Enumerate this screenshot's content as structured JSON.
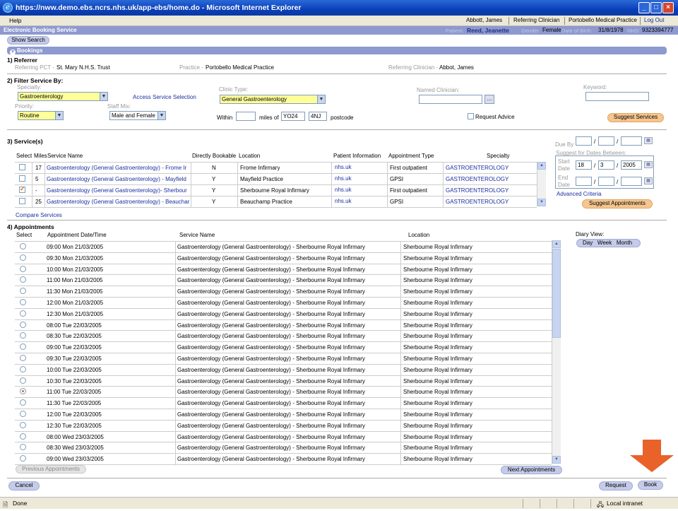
{
  "window": {
    "title": "https://nww.demo.ebs.ncrs.nhs.uk/app-ebs/home.do - Microsoft Internet Explorer"
  },
  "menu": {
    "help": "Help",
    "user": "Abbott, James",
    "role": "Referring Clinician",
    "practice": "Portobello Medical Practice",
    "logout": "Log Out"
  },
  "ebs_bar": {
    "title": "Electronic Booking Service",
    "patient_label": "Patient:",
    "patient": "Reed, Jeanette",
    "gender_label": "Gender",
    "gender": "Female",
    "dob_label": "Date of Birth:",
    "dob": "31/8/1978",
    "nhs_label": "NHS:",
    "nhs": "9323394777"
  },
  "show_search": "Show Search",
  "bookings_title": "Bookings",
  "referrer": {
    "heading": "1) Referrer",
    "pct_label": "Referring PCT -",
    "pct": "St. Mary N.H.S. Trust",
    "practice_label": "Practice -",
    "practice": "Portobello Medical Practice",
    "clinician_label": "Referring Clinician -",
    "clinician": "Abbot, James"
  },
  "filter": {
    "heading": "2) Filter Service By:",
    "specialty_label": "Specialty:",
    "specialty": "Gastroenterology",
    "access_link": "Access Service Selection",
    "clinic_type_label": "Clinic Type:",
    "clinic_type": "General Gastroenterology",
    "named_clinician_label": "Named Clinician:",
    "named_btn": "...",
    "keyword_label": "Keyword:",
    "priority_label": "Priority:",
    "priority": "Routine",
    "staff_mix_label": "Staff Mix:",
    "staff_mix": "Male and Female",
    "within_label": "Within",
    "miles_of_label": "miles of",
    "postcode1": "YO24",
    "postcode2": "4NJ",
    "postcode_label": "postcode",
    "request_advice_label": "Request Advice",
    "suggest_services": "Suggest Services"
  },
  "services": {
    "heading": "3) Service(s)",
    "headers": {
      "select": "Select",
      "miles": "Miles",
      "service_name": "Service Name",
      "directly_bookable": "Directly Bookable",
      "location": "Location",
      "patient_information": "Patient Information",
      "appointment_type": "Appointment Type",
      "specialty": "Specialty"
    },
    "rows": [
      {
        "checked": false,
        "miles": "17",
        "name": "Gastroenterology (General Gastroenterology) - Frome Ir",
        "bookable": "N",
        "location": "Frome Infirmary",
        "info": "nhs.uk",
        "type": "First outpatient",
        "specialty": "GASTROENTEROLOGY"
      },
      {
        "checked": false,
        "miles": "5",
        "name": "Gastroenterology (General Gastroenterology) - Mayfield",
        "bookable": "Y",
        "location": "Mayfield Practice",
        "info": "nhs.uk",
        "type": "GPSI",
        "specialty": "GASTROENTEROLOGY"
      },
      {
        "checked": true,
        "miles": "-",
        "name": "Gastroenterology (General Gastroenterology)- Sherbour",
        "bookable": "Y",
        "location": "Sherbourne Royal Infirmary",
        "info": "nhs.uk",
        "type": "First outpatient",
        "specialty": "GASTROENTEROLOGY"
      },
      {
        "checked": false,
        "miles": "25",
        "name": "Gastroenterology (General Gastroenterology) - Beauchar",
        "bookable": "Y",
        "location": "Beauchamp Practice",
        "info": "nhs.uk",
        "type": "GPSI",
        "specialty": "GASTROENTEROLOGY"
      }
    ],
    "compare": "Compare Services",
    "due_by_label": "Due By",
    "suggest_dates_label": "Suggest for Dates Between:",
    "start_label_1": "Start",
    "start_label_2": "Date",
    "start_day": "18",
    "start_month": "3",
    "start_year": "2005",
    "end_label_1": "End",
    "end_label_2": "Date",
    "slash": "/",
    "advanced": "Advanced Criteria",
    "suggest_appointments": "Suggest Appointments"
  },
  "appointments": {
    "heading": "4) Appointments",
    "headers": {
      "select": "Select",
      "date_time": "Appointment Date/Time",
      "service_name": "Service Name",
      "location": "Location"
    },
    "service": "Gastroenterology (General Gastroenterology) - Sherbourne Royal Infirmary",
    "location": "Sherbourne Royal Infirmary",
    "rows": [
      {
        "time": "09:00 Mon 21/03/2005",
        "selected": false
      },
      {
        "time": "09:30 Mon 21/03/2005",
        "selected": false
      },
      {
        "time": "10:00 Mon 21/03/2005",
        "selected": false
      },
      {
        "time": "11:00 Mon 21/03/2005",
        "selected": false
      },
      {
        "time": "11:30 Mon 21/03/2005",
        "selected": false
      },
      {
        "time": "12:00 Mon 21/03/2005",
        "selected": false
      },
      {
        "time": "12:30 Mon 21/03/2005",
        "selected": false
      },
      {
        "time": "08:00 Tue 22/03/2005",
        "selected": false
      },
      {
        "time": "08:30 Tue 22/03/2005",
        "selected": false
      },
      {
        "time": "09:00 Tue 22/03/2005",
        "selected": false
      },
      {
        "time": "09:30 Tue 22/03/2005",
        "selected": false
      },
      {
        "time": "10:00 Tue 22/03/2005",
        "selected": false
      },
      {
        "time": "10:30 Tue 22/03/2005",
        "selected": false
      },
      {
        "time": "11:00 Tue 22/03/2005",
        "selected": true
      },
      {
        "time": "11:30 Tue 22/03/2005",
        "selected": false
      },
      {
        "time": "12:00 Tue 22/03/2005",
        "selected": false
      },
      {
        "time": "12:30 Tue 22/03/2005",
        "selected": false
      },
      {
        "time": "08:00 Wed 23/03/2005",
        "selected": false
      },
      {
        "time": "08:30 Wed 23/03/2005",
        "selected": false
      },
      {
        "time": "09:00 Wed 23/03/2005",
        "selected": false
      }
    ],
    "diary_view_label": "Diary View:",
    "day": "Day",
    "week": "Week",
    "month": "Month",
    "previous": "Previous Appointments",
    "next": "Next Appointments"
  },
  "footer": {
    "cancel": "Cancel",
    "request": "Request",
    "book": "Book"
  },
  "status": {
    "done": "Done",
    "zone": "Local intranet"
  },
  "colors": {
    "arrow": "#e8622a",
    "header_bar": "#8d99cf",
    "link": "#1a2fa0"
  }
}
